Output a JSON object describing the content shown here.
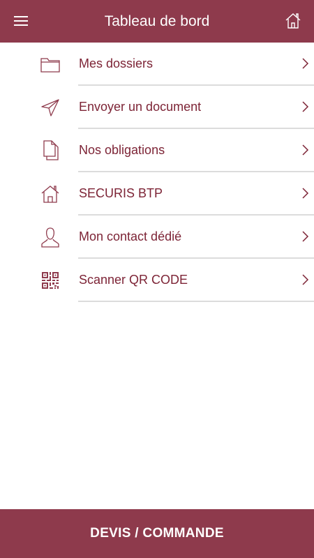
{
  "header": {
    "title": "Tableau de bord",
    "menu_icon": "hamburger-menu-icon",
    "home_icon": "home-icon"
  },
  "menu": {
    "items": [
      {
        "label": "Mes dossiers",
        "icon": "folder-icon"
      },
      {
        "label": "Envoyer un document",
        "icon": "send-paper-plane-icon"
      },
      {
        "label": "Nos obligations",
        "icon": "documents-icon"
      },
      {
        "label": "SECURIS BTP",
        "icon": "house-icon"
      },
      {
        "label": "Mon contact dédié",
        "icon": "user-icon"
      },
      {
        "label": "Scanner QR CODE",
        "icon": "qr-code-icon"
      }
    ]
  },
  "footer": {
    "cta_label": "DEVIS / COMMANDE"
  },
  "colors": {
    "primary": "#8e3a4c",
    "text": "#7d2436",
    "divider": "#dcdcdc",
    "background": "#ffffff"
  }
}
